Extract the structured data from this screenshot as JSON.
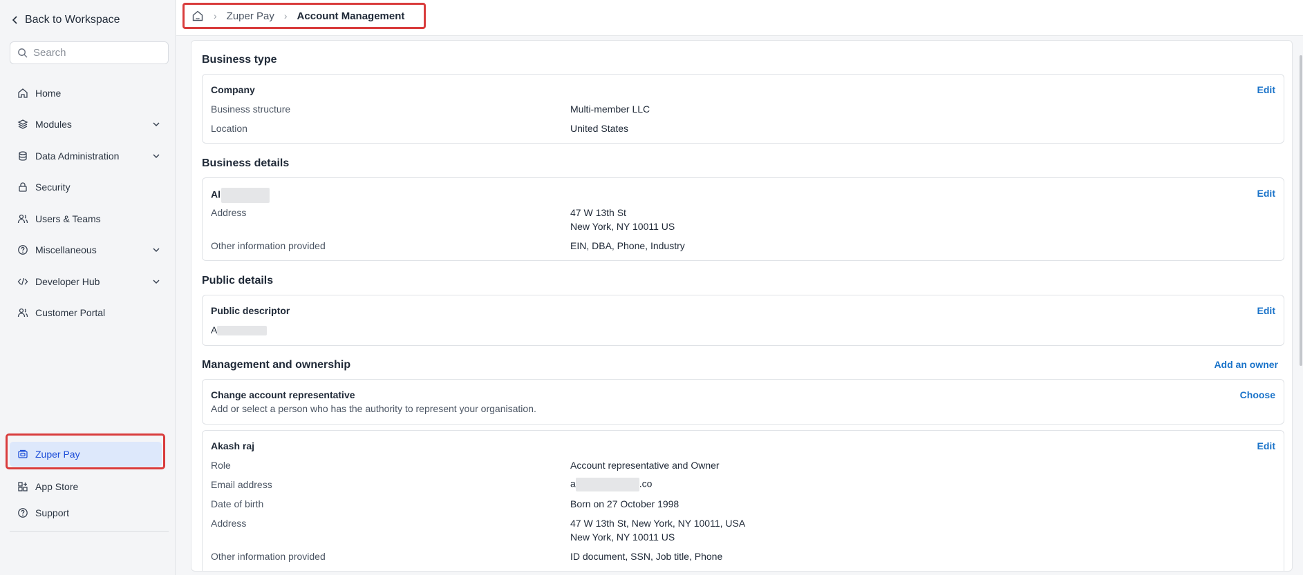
{
  "sidebar": {
    "back_label": "Back to Workspace",
    "search_placeholder": "Search",
    "items": [
      {
        "label": "Home",
        "icon": "home-icon"
      },
      {
        "label": "Modules",
        "icon": "layers-icon",
        "expandable": true
      },
      {
        "label": "Data Administration",
        "icon": "database-icon",
        "expandable": true
      },
      {
        "label": "Security",
        "icon": "lock-icon"
      },
      {
        "label": "Users & Teams",
        "icon": "users-icon"
      },
      {
        "label": "Miscellaneous",
        "icon": "help-circle-icon",
        "expandable": true
      },
      {
        "label": "Developer Hub",
        "icon": "code-icon",
        "expandable": true
      },
      {
        "label": "Customer Portal",
        "icon": "users-icon"
      }
    ],
    "active_item": {
      "label": "Zuper Pay",
      "icon": "wallet-icon"
    },
    "bottom": [
      {
        "label": "App Store",
        "icon": "grid-plus-icon"
      },
      {
        "label": "Support",
        "icon": "help-circle-icon"
      }
    ]
  },
  "breadcrumb": {
    "home_icon": "home-icon",
    "parent": "Zuper Pay",
    "current": "Account Management"
  },
  "colors": {
    "accent": "#1a73c9",
    "highlight_border": "#d93c3c",
    "active_bg": "#dde8fb"
  },
  "sections": {
    "business_type": {
      "title": "Business type",
      "card_title": "Company",
      "edit": "Edit",
      "rows": [
        {
          "label": "Business structure",
          "value": "Multi-member LLC"
        },
        {
          "label": "Location",
          "value": "United States"
        }
      ]
    },
    "business_details": {
      "title": "Business details",
      "card_title": "Al",
      "edit": "Edit",
      "address_label": "Address",
      "address_lines": [
        "47 W 13th St",
        "New York, NY 10011 US"
      ],
      "other_label": "Other information provided",
      "other_value": "EIN, DBA, Phone, Industry"
    },
    "public_details": {
      "title": "Public details",
      "card_title": "Public descriptor",
      "edit": "Edit",
      "value": "A"
    },
    "management": {
      "title": "Management and ownership",
      "add_owner": "Add an owner",
      "representative": {
        "title": "Change account representative",
        "description": "Add or select a person who has the authority to represent your organisation.",
        "action": "Choose"
      },
      "owner": {
        "name": "Akash raj",
        "edit": "Edit",
        "rows": [
          {
            "label": "Role",
            "value": "Account representative and Owner"
          },
          {
            "label": "Email address",
            "value_prefix": "a",
            "value_suffix": ".co"
          },
          {
            "label": "Date of birth",
            "value": "Born on 27 October 1998"
          }
        ],
        "address_label": "Address",
        "address_lines": [
          "47 W 13th St, New York, NY 10011, USA",
          "New York, NY 10011 US"
        ],
        "other_label": "Other information provided",
        "other_value": "ID document, SSN, Job title, Phone"
      }
    }
  }
}
